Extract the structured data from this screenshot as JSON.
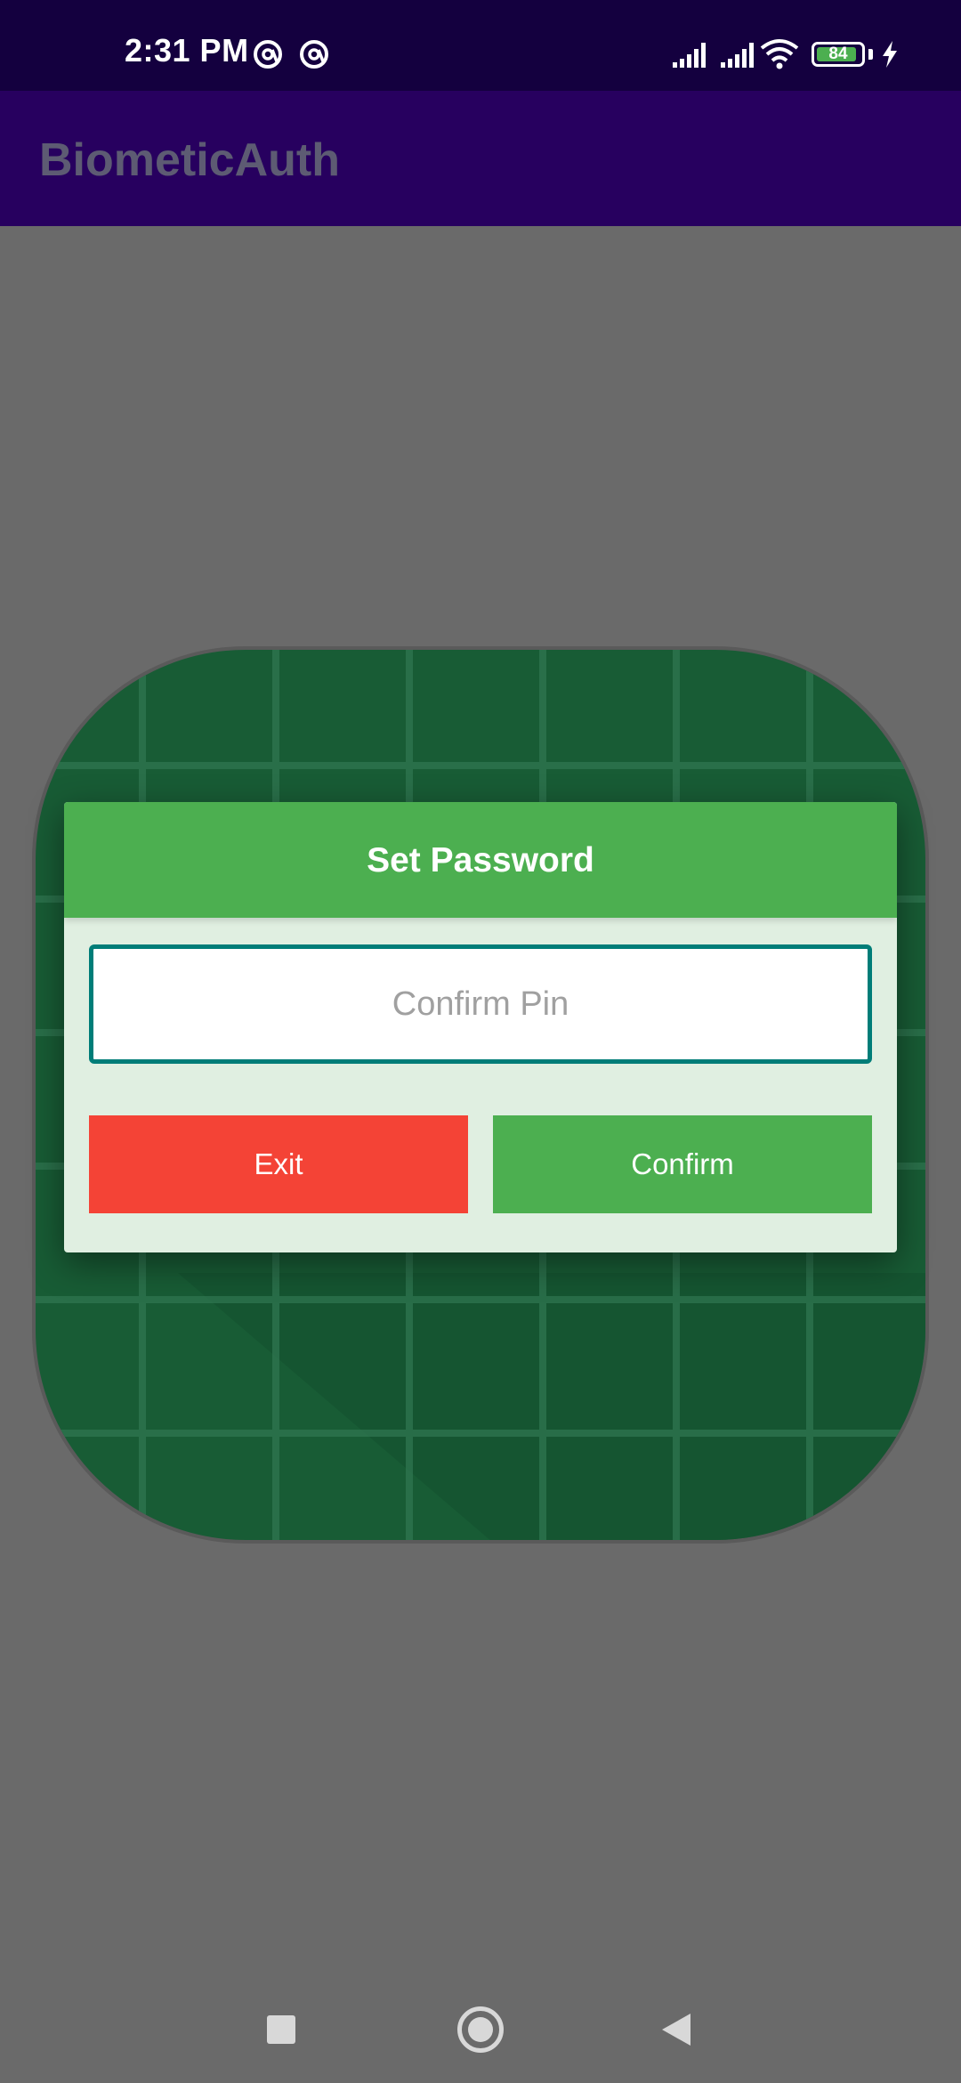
{
  "status_bar": {
    "time": "2:31 PM",
    "notification_icons": [
      "at-sign-circle-icon",
      "at-sign-circle-icon"
    ],
    "battery_level": "84",
    "charging": true
  },
  "app_bar": {
    "title": "BiometicAuth"
  },
  "dialog": {
    "title": "Set Password",
    "pin_input": {
      "value": "",
      "placeholder": "Confirm Pin"
    },
    "exit_label": "Exit",
    "confirm_label": "Confirm"
  },
  "colors": {
    "status_bar": "#14003f",
    "app_bar": "#27005f",
    "scrim": "#6a6a6a",
    "logo_green": "#185c35",
    "dialog_header": "#4caf50",
    "dialog_body": "#e0efe1",
    "input_border": "#007d78",
    "exit_button": "#f44336",
    "confirm_button": "#4caf50"
  },
  "nav_bar": {
    "icons": [
      "recents-square-icon",
      "home-circle-icon",
      "back-triangle-icon"
    ]
  }
}
